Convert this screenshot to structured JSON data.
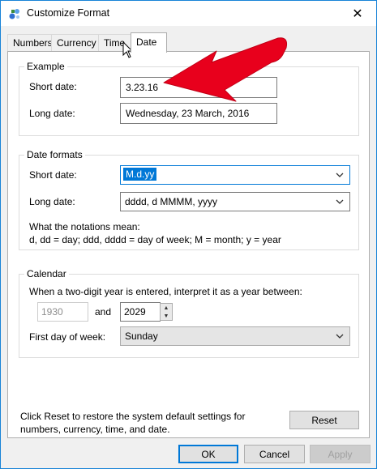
{
  "window": {
    "title": "Customize Format",
    "close_glyph": "✕"
  },
  "tabs": [
    {
      "label": "Numbers"
    },
    {
      "label": "Currency"
    },
    {
      "label": "Time"
    },
    {
      "label": "Date",
      "active": true
    }
  ],
  "example": {
    "title": "Example",
    "short_label": "Short date:",
    "short_value": "3.23.16",
    "long_label": "Long date:",
    "long_value": "Wednesday, 23 March, 2016"
  },
  "date_formats": {
    "title": "Date formats",
    "short_label": "Short date:",
    "short_value": "M.d.yy",
    "long_label": "Long date:",
    "long_value": "dddd, d MMMM, yyyy",
    "notations_title": "What the notations mean:",
    "notations_text": "d, dd = day;  ddd, dddd = day of week;  M = month;  y = year"
  },
  "calendar": {
    "title": "Calendar",
    "two_digit_text": "When a two-digit year is entered, interpret it as a year between:",
    "year_from": "1930",
    "and_label": "and",
    "year_to": "2029",
    "first_day_label": "First day of week:",
    "first_day_value": "Sunday"
  },
  "reset": {
    "description": "Click Reset to restore the system default settings for numbers, currency, time, and date.",
    "button_label": "Reset"
  },
  "footer": {
    "ok_label": "OK",
    "cancel_label": "Cancel",
    "apply_label": "Apply"
  },
  "colors": {
    "accent": "#0078d7",
    "annotation_arrow": "#e8001c"
  }
}
